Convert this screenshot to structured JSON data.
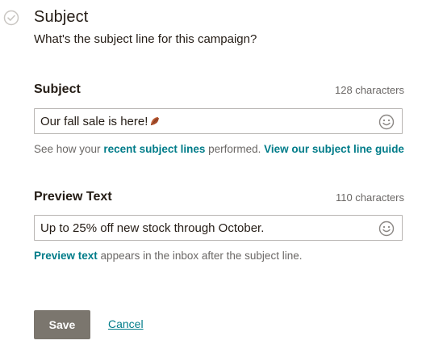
{
  "section": {
    "title": "Subject",
    "subtitle": "What's the subject line for this campaign?"
  },
  "subject_field": {
    "label": "Subject",
    "count": "128 characters",
    "value": "Our fall sale is here!",
    "value_emoji": "fallen-leaf",
    "emoji_button_icon": "smiley-icon"
  },
  "subject_help": {
    "prefix": "See how your ",
    "link1": "recent subject lines",
    "middle": " performed. ",
    "link2": "View our subject line guide"
  },
  "preview_field": {
    "label": "Preview Text",
    "count": "110 characters",
    "value": "Up to 25% off new stock through October.",
    "emoji_button_icon": "smiley-icon"
  },
  "preview_help": {
    "link": "Preview text",
    "suffix": " appears in the inbox after the subject line."
  },
  "actions": {
    "save_label": "Save",
    "cancel_label": "Cancel"
  },
  "colors": {
    "link": "#007c89",
    "button_bg": "#7b766e",
    "text": "#241c15",
    "muted": "#6b6866"
  }
}
